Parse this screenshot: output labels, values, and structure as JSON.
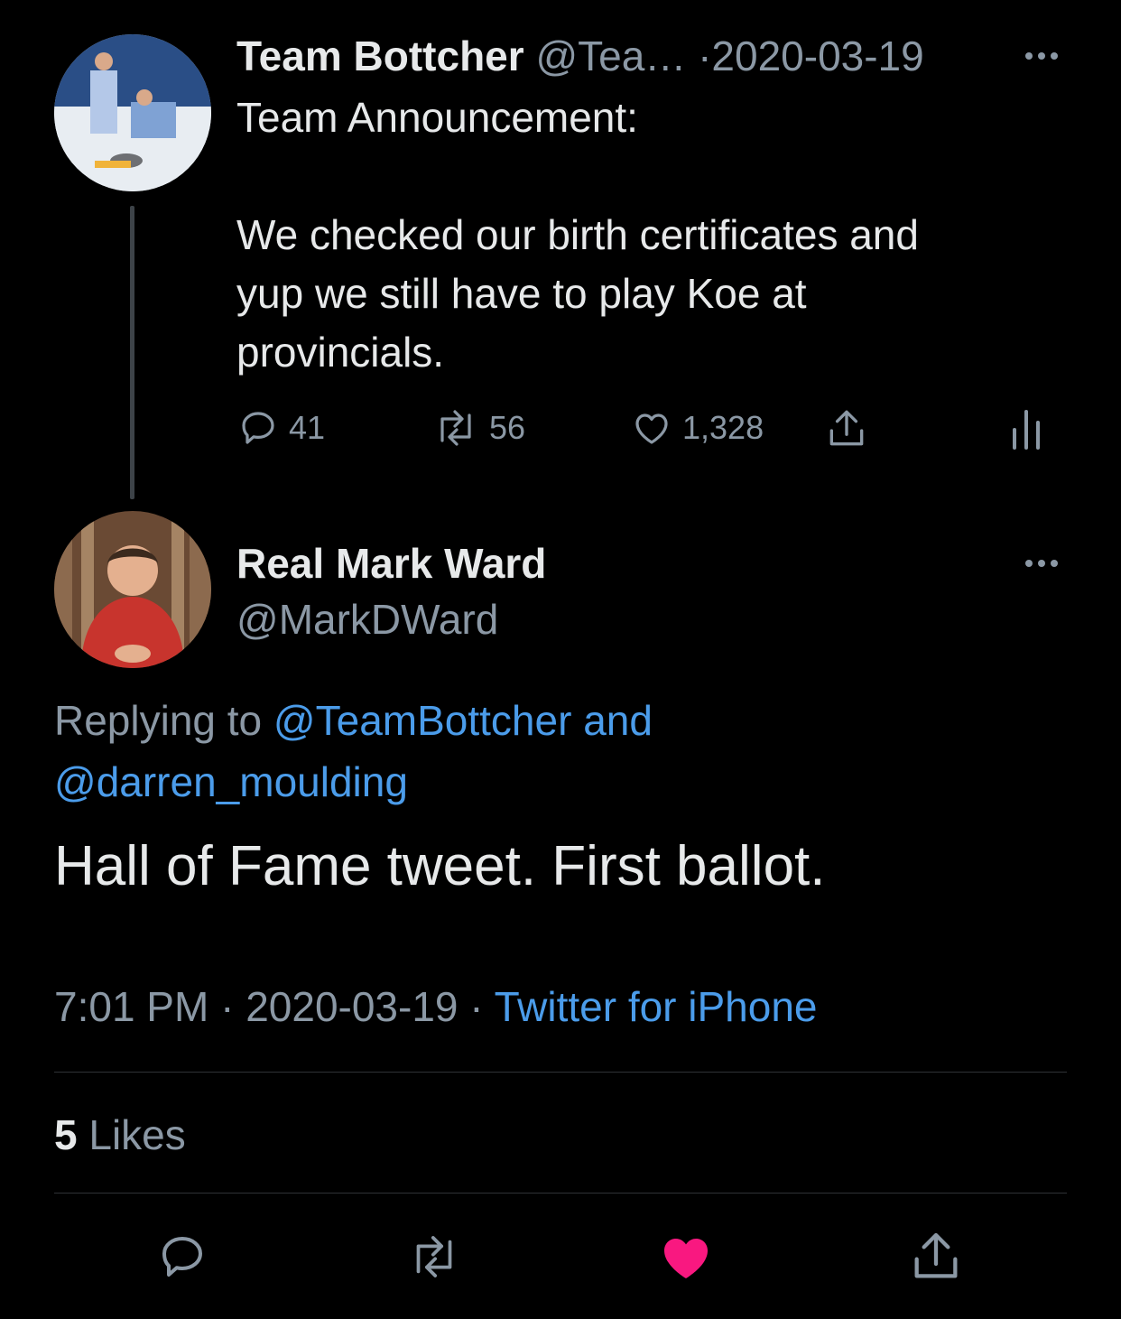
{
  "original_tweet": {
    "display_name": "Team Bottcher",
    "handle": "@Tea…",
    "separator": "·",
    "date": "2020-03-19",
    "text_line1": "Team Announcement:",
    "text_para2_line1": "We checked our birth certificates and",
    "text_para2_line2": "yup we still have to play Koe at",
    "text_para2_line3": "provincials.",
    "replies": "41",
    "retweets": "56",
    "likes": "1,328"
  },
  "reply_tweet": {
    "display_name": "Real Mark Ward",
    "handle": "@MarkDWard",
    "replying_prefix": "Replying to",
    "replying_handle1": "@TeamBottcher",
    "replying_and": "and",
    "replying_handle2": "@darren_moulding",
    "text": "Hall of Fame tweet. First ballot.",
    "time": "7:01 PM",
    "sep1": "·",
    "date": "2020-03-19",
    "sep2": "·",
    "source": "Twitter for iPhone",
    "likes_count": "5",
    "likes_label": "Likes"
  },
  "icons": {
    "reply": "reply-icon",
    "retweet": "retweet-icon",
    "like": "heart-icon",
    "share": "share-icon",
    "analytics": "analytics-icon",
    "more": "more-icon"
  },
  "colors": {
    "background": "#000000",
    "link": "#4b9cea",
    "muted": "#8b98a5",
    "liked": "#f91880"
  }
}
